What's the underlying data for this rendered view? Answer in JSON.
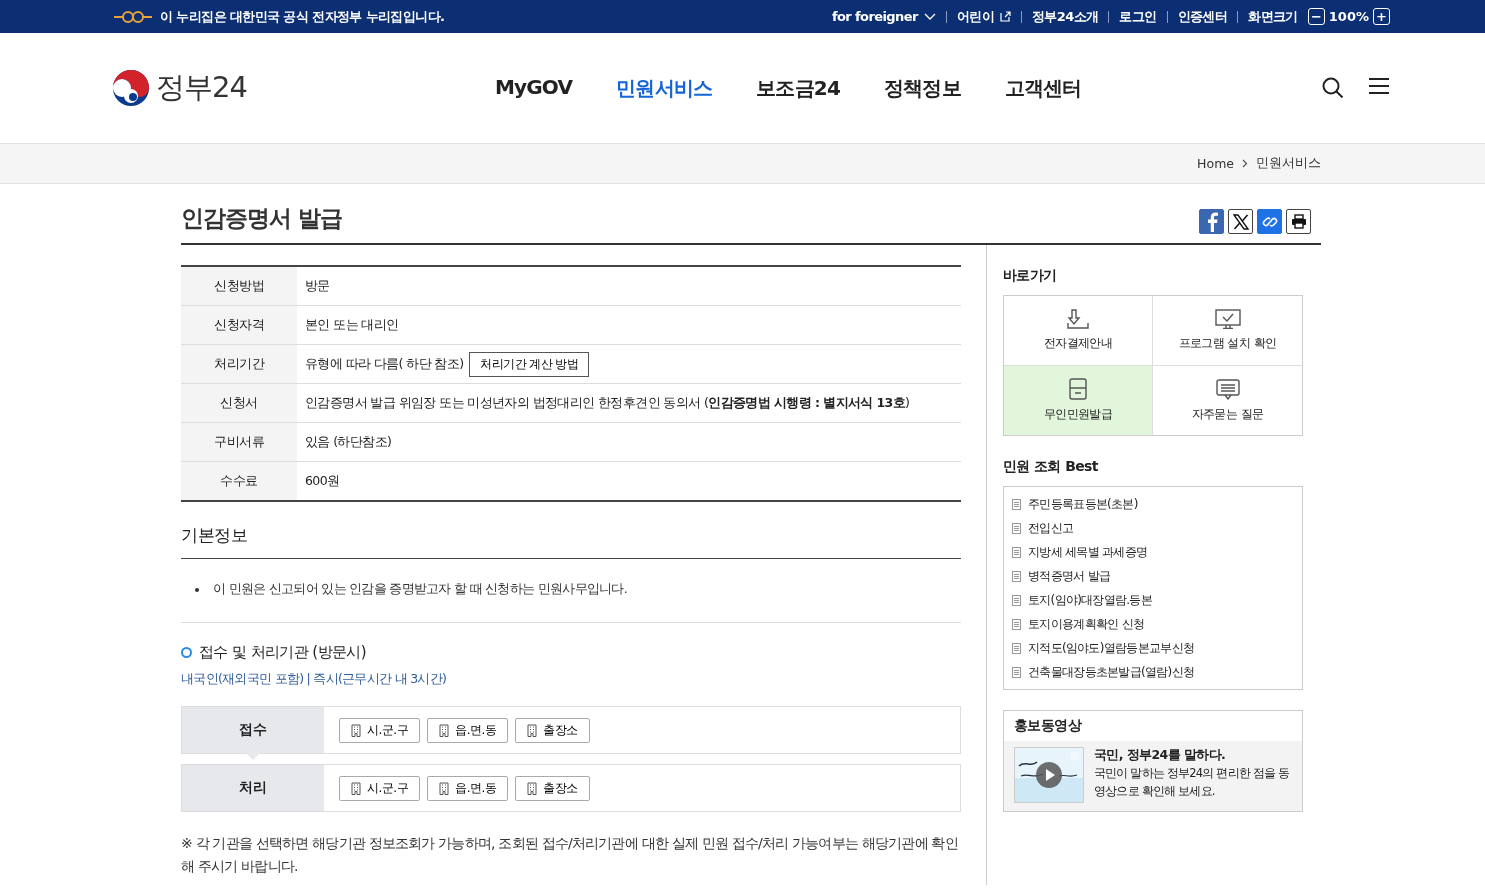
{
  "top_bar": {
    "notice": "이 누리집은 대한민국 공식 전자정부 누리집입니다.",
    "links": [
      {
        "label": "for foreigner",
        "kind": "dropdown"
      },
      {
        "label": "어린이",
        "kind": "external"
      },
      {
        "label": "정부24소개",
        "kind": "plain"
      },
      {
        "label": "로그인",
        "kind": "plain"
      },
      {
        "label": "인증센터",
        "kind": "plain"
      },
      {
        "label": "화면크기",
        "kind": "plain"
      }
    ],
    "zoom": {
      "decrease": "−",
      "level": "100%",
      "increase": "+"
    }
  },
  "header": {
    "logo": "정부24",
    "nav": [
      {
        "label": "MyGOV",
        "selected": false
      },
      {
        "label": "민원서비스",
        "selected": true
      },
      {
        "label": "보조금24",
        "selected": false
      },
      {
        "label": "정책정보",
        "selected": false
      },
      {
        "label": "고객센터",
        "selected": false
      }
    ]
  },
  "breadcrumb": [
    "Home",
    "민원서비스"
  ],
  "page_title": "인감증명서 발급",
  "info_table": [
    {
      "label": "신청방법",
      "value": "방문"
    },
    {
      "label": "신청자격",
      "value": "본인 또는 대리인"
    },
    {
      "label": "처리기간",
      "value": "유형에 따라 다름( 하단 참조)",
      "button": "처리기간 계산 방법"
    },
    {
      "label": "신청서",
      "value": "인감증명서 발급 위임장 또는 미성년자의 법정대리인 한정후견인 동의서 (**인감증명법 시행령 : 별지서식 13호**)"
    },
    {
      "label": "구비서류",
      "value": "있음 (하단참조)"
    },
    {
      "label": "수수료",
      "value": "600원"
    }
  ],
  "basic_info": {
    "title": "기본정보",
    "bullets": [
      "이 민원은 신고되어 있는 인감을 증명받고자 할 때 신청하는 민원사무입니다."
    ]
  },
  "agencies": {
    "title": "접수 및 처리기관 (방문시)",
    "subtitle": "내국인(재외국민 포함) | 즉시(근무시간 내 3시간)",
    "rows": [
      {
        "label": "접수",
        "offices": [
          "시.군.구",
          "읍.면.동",
          "출장소"
        ]
      },
      {
        "label": "처리",
        "offices": [
          "시.군.구",
          "읍.면.동",
          "출장소"
        ]
      }
    ],
    "note": "※ 각 기관을 선택하면 해당기관 정보조회가 가능하며, 조회된 접수/처리기관에 대한 실제 민원 접수/처리 가능여부는 해당기관에 확인해 주시기 바랍니다."
  },
  "sidebar": {
    "shortcuts": {
      "title": "바로가기",
      "items": [
        {
          "label": "전자결제안내",
          "kind": "download",
          "selected": false
        },
        {
          "label": "프로그램 설치 확인",
          "kind": "monitor",
          "selected": false
        },
        {
          "label": "무인민원발급",
          "kind": "kiosk",
          "selected": true
        },
        {
          "label": "자주묻는 질문",
          "kind": "chat",
          "selected": false
        }
      ]
    },
    "best": {
      "title": "민원 조회 Best",
      "items": [
        "주민등록표등본(초본)",
        "전입신고",
        "지방세 세목별 과세증명",
        "병적증명서 발급",
        "토지(임야)대장열람.등본",
        "토지이용계획확인 신청",
        "지적도(임야도)열람등본교부신청",
        "건축물대장등초본발급(열람)신청"
      ]
    },
    "video": {
      "title": "홍보동영상",
      "headline": "국민, 정부24를 말하다.",
      "description": "국민이 말하는 정부24의 편리한 점을 동영상으로 확인해 보세요."
    }
  }
}
